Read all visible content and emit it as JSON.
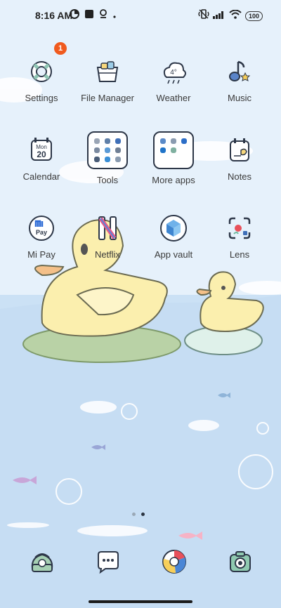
{
  "status_bar": {
    "time": "8:16 AM",
    "battery": "100",
    "left_icons": [
      "data-saver-icon",
      "square-notification-icon",
      "location-pin-icon",
      "more-dot-icon"
    ],
    "right_icons": [
      "vibrate-icon",
      "signal-icon",
      "wifi-icon",
      "battery-icon"
    ]
  },
  "apps": [
    {
      "label": "Settings",
      "icon": "lifebuoy-settings-icon",
      "badge": "1"
    },
    {
      "label": "File Manager",
      "icon": "basket-folder-icon"
    },
    {
      "label": "Weather",
      "icon": "cloud-weather-icon",
      "temp": "4°"
    },
    {
      "label": "Music",
      "icon": "music-note-icon"
    },
    {
      "label": "Calendar",
      "icon": "calendar-icon",
      "month": "Mon",
      "day": "20"
    },
    {
      "label": "Tools",
      "icon": "tools-folder-icon"
    },
    {
      "label": "More apps",
      "icon": "more-apps-folder-icon"
    },
    {
      "label": "Notes",
      "icon": "notes-icon"
    },
    {
      "label": "Mi Pay",
      "icon": "mi-pay-icon",
      "icon_text": "Pay"
    },
    {
      "label": "Netflix",
      "icon": "netflix-icon"
    },
    {
      "label": "App vault",
      "icon": "app-vault-icon"
    },
    {
      "label": "Lens",
      "icon": "lens-icon"
    }
  ],
  "dock": [
    {
      "icon": "phone-icon"
    },
    {
      "icon": "messages-icon"
    },
    {
      "icon": "browser-icon"
    },
    {
      "icon": "camera-icon"
    }
  ],
  "page_indicator": {
    "pages": 2,
    "active": 2
  },
  "colors": {
    "accent": "#f05a1e",
    "sky": "#e4f0fb",
    "water": "#c9e0f5",
    "duck": "#fbefae",
    "outline": "#2d3748"
  }
}
